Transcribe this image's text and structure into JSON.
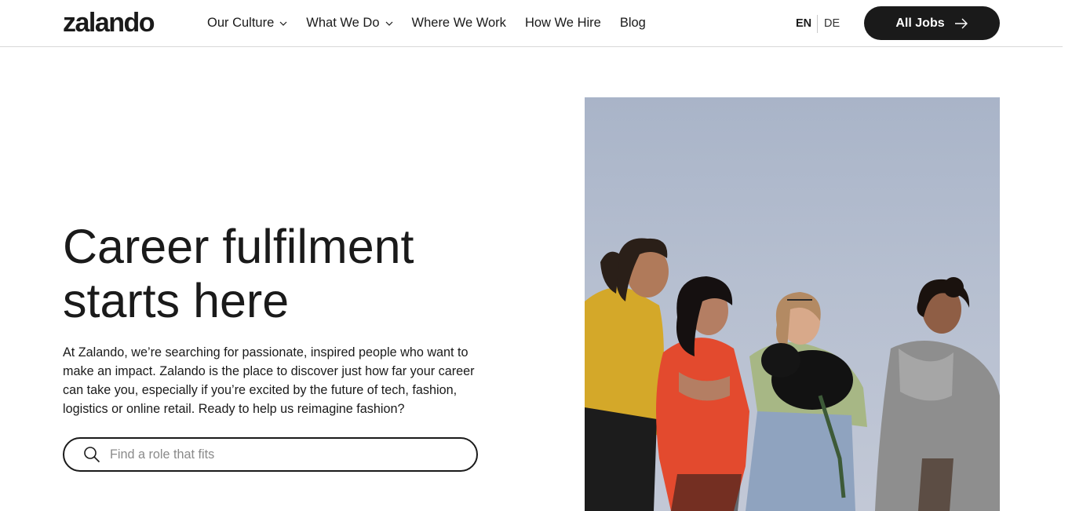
{
  "header": {
    "logo_text": "zalando",
    "nav": [
      {
        "label": "Our Culture",
        "has_dropdown": true
      },
      {
        "label": "What We Do",
        "has_dropdown": true
      },
      {
        "label": "Where We Work",
        "has_dropdown": false
      },
      {
        "label": "How We Hire",
        "has_dropdown": false
      },
      {
        "label": "Blog",
        "has_dropdown": false
      }
    ],
    "lang_en": "EN",
    "lang_de": "DE",
    "all_jobs_label": "All Jobs"
  },
  "hero": {
    "title_line1": "Career fulfilment",
    "title_line2": "starts here",
    "text": "At Zalando, we’re searching for passionate, inspired people who want to make an impact. Zalando is the place to discover just how far your career can take you, especially if you’re excited by the future of tech, fashion, logistics or online retail. Ready to help us reimagine fashion?",
    "search_placeholder": "Find a role that fits",
    "photo_alt": "Four people smiling outdoors against a pale sky, one holding a small black dog"
  },
  "icons": {
    "chevron": "chevron-down-icon",
    "arrow": "arrow-right-icon",
    "search": "search-icon"
  },
  "colors": {
    "text": "#1a1a1a",
    "button_bg": "#1a1a1a",
    "button_text": "#ffffff",
    "sky": "#b4bdcf"
  }
}
